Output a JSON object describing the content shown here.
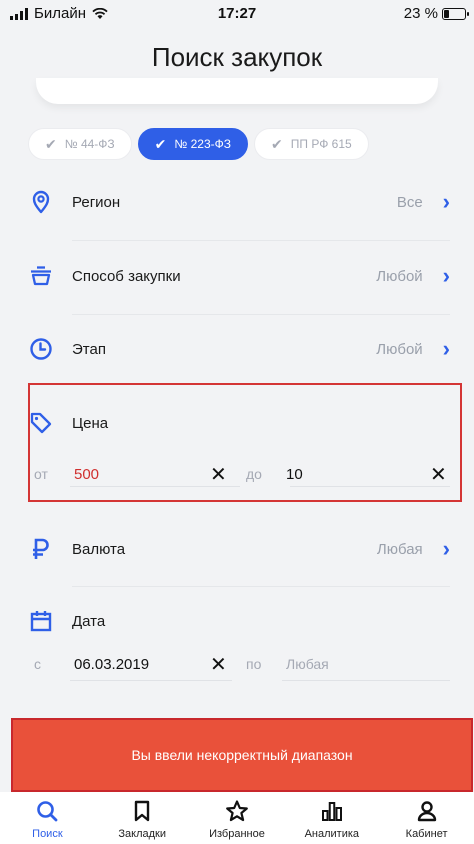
{
  "status_bar": {
    "carrier": "Билайн",
    "time": "17:27",
    "battery": "23 %",
    "battery_level": 0.23
  },
  "header": {
    "title": "Поиск закупок"
  },
  "law_chips": [
    {
      "label": "№ 44-ФЗ",
      "active": false
    },
    {
      "label": "№ 223-ФЗ",
      "active": true
    },
    {
      "label": "ПП РФ 615",
      "active": false
    }
  ],
  "filters": {
    "region": {
      "label": "Регион",
      "value": "Все"
    },
    "procurement_method": {
      "label": "Способ закупки",
      "value": "Любой"
    },
    "stage": {
      "label": "Этап",
      "value": "Любой"
    },
    "price": {
      "label": "Цена",
      "from_prefix": "от",
      "from_value": "500",
      "to_prefix": "до",
      "to_value": "10"
    },
    "currency": {
      "label": "Валюта",
      "value": "Любая"
    },
    "date": {
      "label": "Дата",
      "from_prefix": "с",
      "from_value": "06.03.2019",
      "to_prefix": "по",
      "to_placeholder": "Любая"
    }
  },
  "error_message": "Вы ввели некорректный диапазон",
  "tabbar": [
    {
      "label": "Поиск",
      "icon": "search-icon",
      "active": true
    },
    {
      "label": "Закладки",
      "icon": "bookmark-icon",
      "active": false
    },
    {
      "label": "Избранное",
      "icon": "star-icon",
      "active": false
    },
    {
      "label": "Аналитика",
      "icon": "chart-icon",
      "active": false
    },
    {
      "label": "Кабинет",
      "icon": "user-icon",
      "active": false
    }
  ],
  "colors": {
    "accent": "#2f5fe7",
    "error": "#e9513a",
    "invalid_value": "#d0302f",
    "highlight_border": "#d43535"
  }
}
